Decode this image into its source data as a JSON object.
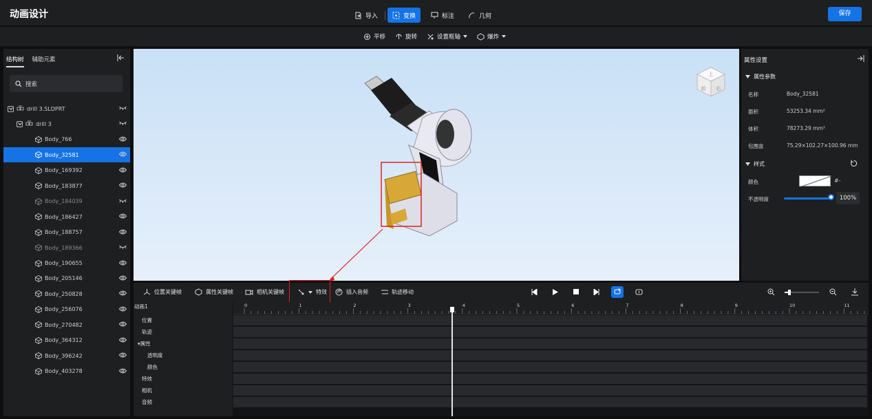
{
  "header": {
    "title": "动画设计",
    "nav": [
      {
        "label": "导入",
        "icon": "import-icon"
      },
      {
        "label": "变换",
        "icon": "transform-icon",
        "active": true
      },
      {
        "label": "标注",
        "icon": "annotation-icon"
      },
      {
        "label": "几何",
        "icon": "geometry-icon"
      }
    ],
    "save_label": "保存"
  },
  "subtoolbar": {
    "items": [
      {
        "label": "平移",
        "icon": "move-icon"
      },
      {
        "label": "旋转",
        "icon": "rotate-icon"
      },
      {
        "label": "设置枢轴",
        "icon": "pivot-icon"
      },
      {
        "label": "爆炸",
        "icon": "explode-icon"
      }
    ]
  },
  "left_panel": {
    "tabs": [
      "结构树",
      "辅助元素"
    ],
    "search_placeholder": "搜索",
    "tree": [
      {
        "label": "drill 3.SLDPRT",
        "level": 0,
        "expand": true,
        "hidden": true
      },
      {
        "label": "drill 3",
        "level": 1,
        "expand": true,
        "hidden": true
      },
      {
        "label": "Body_766",
        "level": 2
      },
      {
        "label": "Body_32581",
        "level": 2,
        "selected": true
      },
      {
        "label": "Body_169392",
        "level": 2
      },
      {
        "label": "Body_183877",
        "level": 2
      },
      {
        "label": "Body_184039",
        "level": 2,
        "hidden": true
      },
      {
        "label": "Body_186427",
        "level": 2
      },
      {
        "label": "Body_188757",
        "level": 2
      },
      {
        "label": "Body_189366",
        "level": 2,
        "hidden": true
      },
      {
        "label": "Body_190655",
        "level": 2
      },
      {
        "label": "Body_205146",
        "level": 2
      },
      {
        "label": "Body_250828",
        "level": 2
      },
      {
        "label": "Body_256076",
        "level": 2
      },
      {
        "label": "Body_270482",
        "level": 2
      },
      {
        "label": "Body_364312",
        "level": 2
      },
      {
        "label": "Body_396242",
        "level": 2
      },
      {
        "label": "Body_403278",
        "level": 2
      }
    ]
  },
  "viewcube": {
    "top": "上",
    "front": "前",
    "right": "右"
  },
  "right_panel": {
    "title": "属性设置",
    "section_params": "属性参数",
    "props": [
      {
        "label": "名称",
        "value": "Body_32581"
      },
      {
        "label": "面积",
        "value": "53253.34 mm²"
      },
      {
        "label": "体积",
        "value": "78273.29 mm³"
      },
      {
        "label": "包围盒",
        "value": "75.29×102.27×100.96 mm"
      }
    ],
    "section_style": "样式",
    "color_label": "颜色",
    "color_hex": "#-",
    "opacity_label": "不透明度",
    "opacity_value": "100%",
    "opacity": 1.0
  },
  "timeline": {
    "tools": [
      {
        "label": "位置关键帧",
        "icon": "position-keyframe-icon"
      },
      {
        "label": "属性关键帧",
        "icon": "property-keyframe-icon"
      },
      {
        "label": "相机关键帧",
        "icon": "camera-keyframe-icon"
      },
      {
        "label": "特效",
        "icon": "effects-icon"
      },
      {
        "label": "插入音频",
        "icon": "insert-audio-icon"
      },
      {
        "label": "轨迹移动",
        "icon": "path-move-icon"
      }
    ],
    "animation_name": "动画1",
    "rows": [
      {
        "label": "位置"
      },
      {
        "label": "轨迹"
      },
      {
        "label": "▾属性"
      },
      {
        "label": "透明度"
      },
      {
        "label": "颜色"
      },
      {
        "label": "特效"
      },
      {
        "label": "相机"
      },
      {
        "label": "音频"
      }
    ],
    "ticks": [
      "0",
      "1",
      "2",
      "3",
      "4",
      "5",
      "6",
      "7",
      "8",
      "9",
      "10",
      "11"
    ],
    "playhead_time": 3.8
  }
}
